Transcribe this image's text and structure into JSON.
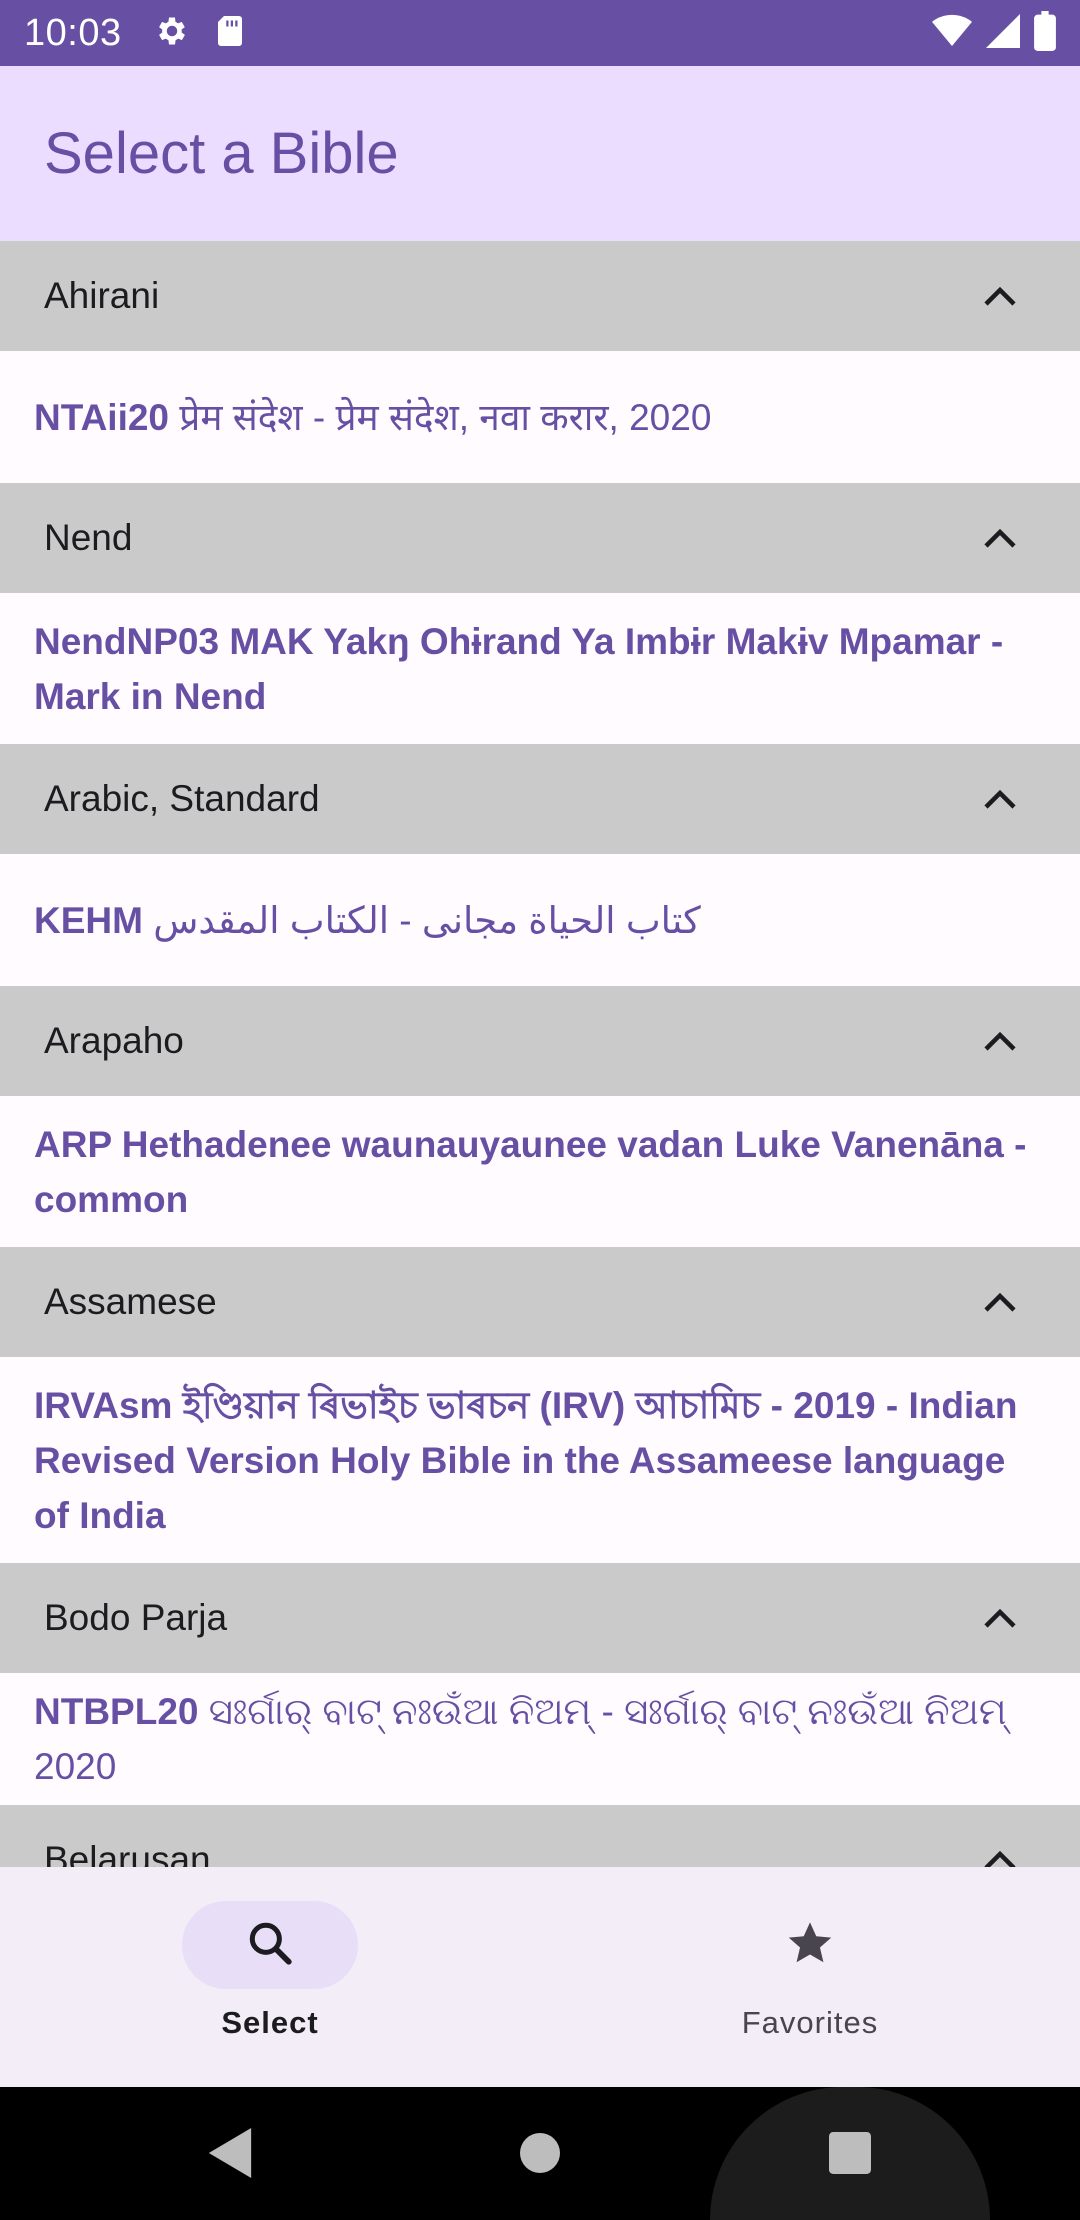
{
  "status_bar": {
    "time": "10:03",
    "icons_left": [
      "gear-icon",
      "sd-card-icon"
    ],
    "icons_right": [
      "wifi-icon",
      "signal-icon",
      "battery-icon"
    ]
  },
  "app_bar": {
    "title": "Select a Bible"
  },
  "groups": [
    {
      "name": "Ahirani",
      "expanded": true,
      "bible_code": "NTAii20",
      "bible_name": "प्रेम संदेश - प्रेम संदेश, नवा करार, 2020"
    },
    {
      "name": "Nend",
      "expanded": true,
      "bible_code": "NendNP03 MAK",
      "bible_name": "Yakŋ Ohɨrand Ya Imbɨr Makɨv Mpamar - Mark in Nend"
    },
    {
      "name": "Arabic, Standard",
      "expanded": true,
      "bible_code": "KEHM",
      "bible_name": "كتاب الحياة مجانى - الكتاب المقدس"
    },
    {
      "name": "Arapaho",
      "expanded": true,
      "bible_code": "ARP",
      "bible_name": "Hethadenee waunauyaunee vadan Luke Vanenāna - common"
    },
    {
      "name": "Assamese",
      "expanded": true,
      "bible_code": "IRVAsm",
      "bible_name": "ইণ্ডিয়ান ৰিভাইচ ভাৰচন (IRV) আচামিচ - 2019 - Indian Revised Version Holy Bible in the Assameese language of India"
    },
    {
      "name": "Bodo Parja",
      "expanded": true,
      "bible_code": "NTBPL20",
      "bible_name": "ସଃର୍ଗାର୍ ବାଟ୍ ନଃଉଁଆ ନିଅମ୍ - ସଃର୍ଗାର୍ ବାଟ୍ ନଃଉଁଆ ନିଅମ୍ 2020"
    },
    {
      "name": "Belarusan",
      "expanded": true
    }
  ],
  "bottom_nav": {
    "items": [
      {
        "label": "Select",
        "icon": "search-icon",
        "active": true
      },
      {
        "label": "Favorites",
        "icon": "star-icon",
        "active": false
      }
    ]
  },
  "system_nav": {
    "buttons": [
      "back-icon",
      "home-icon",
      "recents-icon"
    ]
  },
  "colors": {
    "status_bar": "#6750a4",
    "app_bar": "#eaddff",
    "accent_text": "#6750a4",
    "group_header": "#cacaca",
    "bottom_nav": "#f3edf7",
    "nav_active_pill": "#e8def8"
  }
}
